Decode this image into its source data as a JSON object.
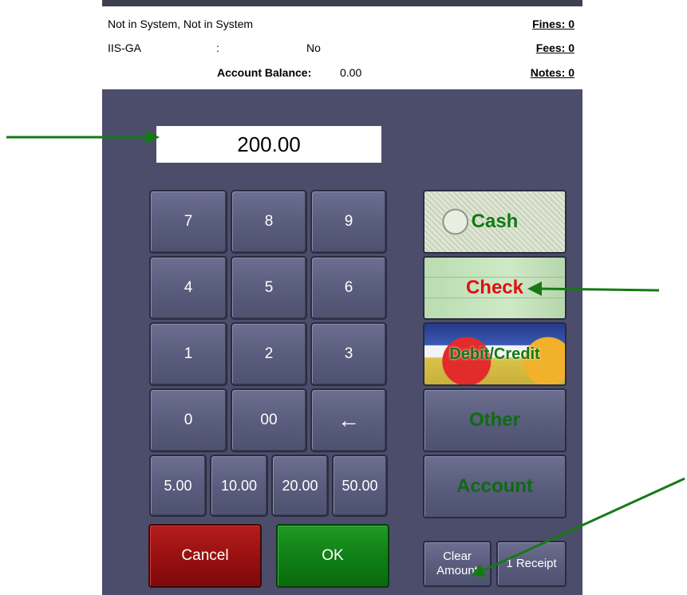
{
  "header": {
    "patron_name": "Not in System, Not in System",
    "library_code": "IIS-GA",
    "separator": ":",
    "flag_value": "No",
    "balance_label": "Account Balance:",
    "balance_value": "0.00",
    "fines_link": "Fines: 0",
    "fees_link": "Fees: 0",
    "notes_link": "Notes: 0"
  },
  "amount_display": "200.00",
  "keypad": {
    "row1": [
      "7",
      "8",
      "9"
    ],
    "row2": [
      "4",
      "5",
      "6"
    ],
    "row3": [
      "1",
      "2",
      "3"
    ],
    "row4": [
      "0",
      "00",
      "←"
    ],
    "quick_amounts": [
      "5.00",
      "10.00",
      "20.00",
      "50.00"
    ]
  },
  "actions": {
    "cancel": "Cancel",
    "ok": "OK",
    "clear_line1": "Clear",
    "clear_line2": "Amount",
    "receipt": "1 Receipt"
  },
  "payment_types": {
    "cash": "Cash",
    "check": "Check",
    "card": "Debit/Credit",
    "other": "Other",
    "account": "Account"
  },
  "colors": {
    "panel_bg": "#4b4d6b",
    "annotation_arrow": "#157a15",
    "cash_text": "#0f7a13",
    "check_text": "#e01010"
  },
  "annotations": [
    "arrow-to-amount-field",
    "arrow-to-check-button",
    "arrow-to-clear-amount-button"
  ]
}
